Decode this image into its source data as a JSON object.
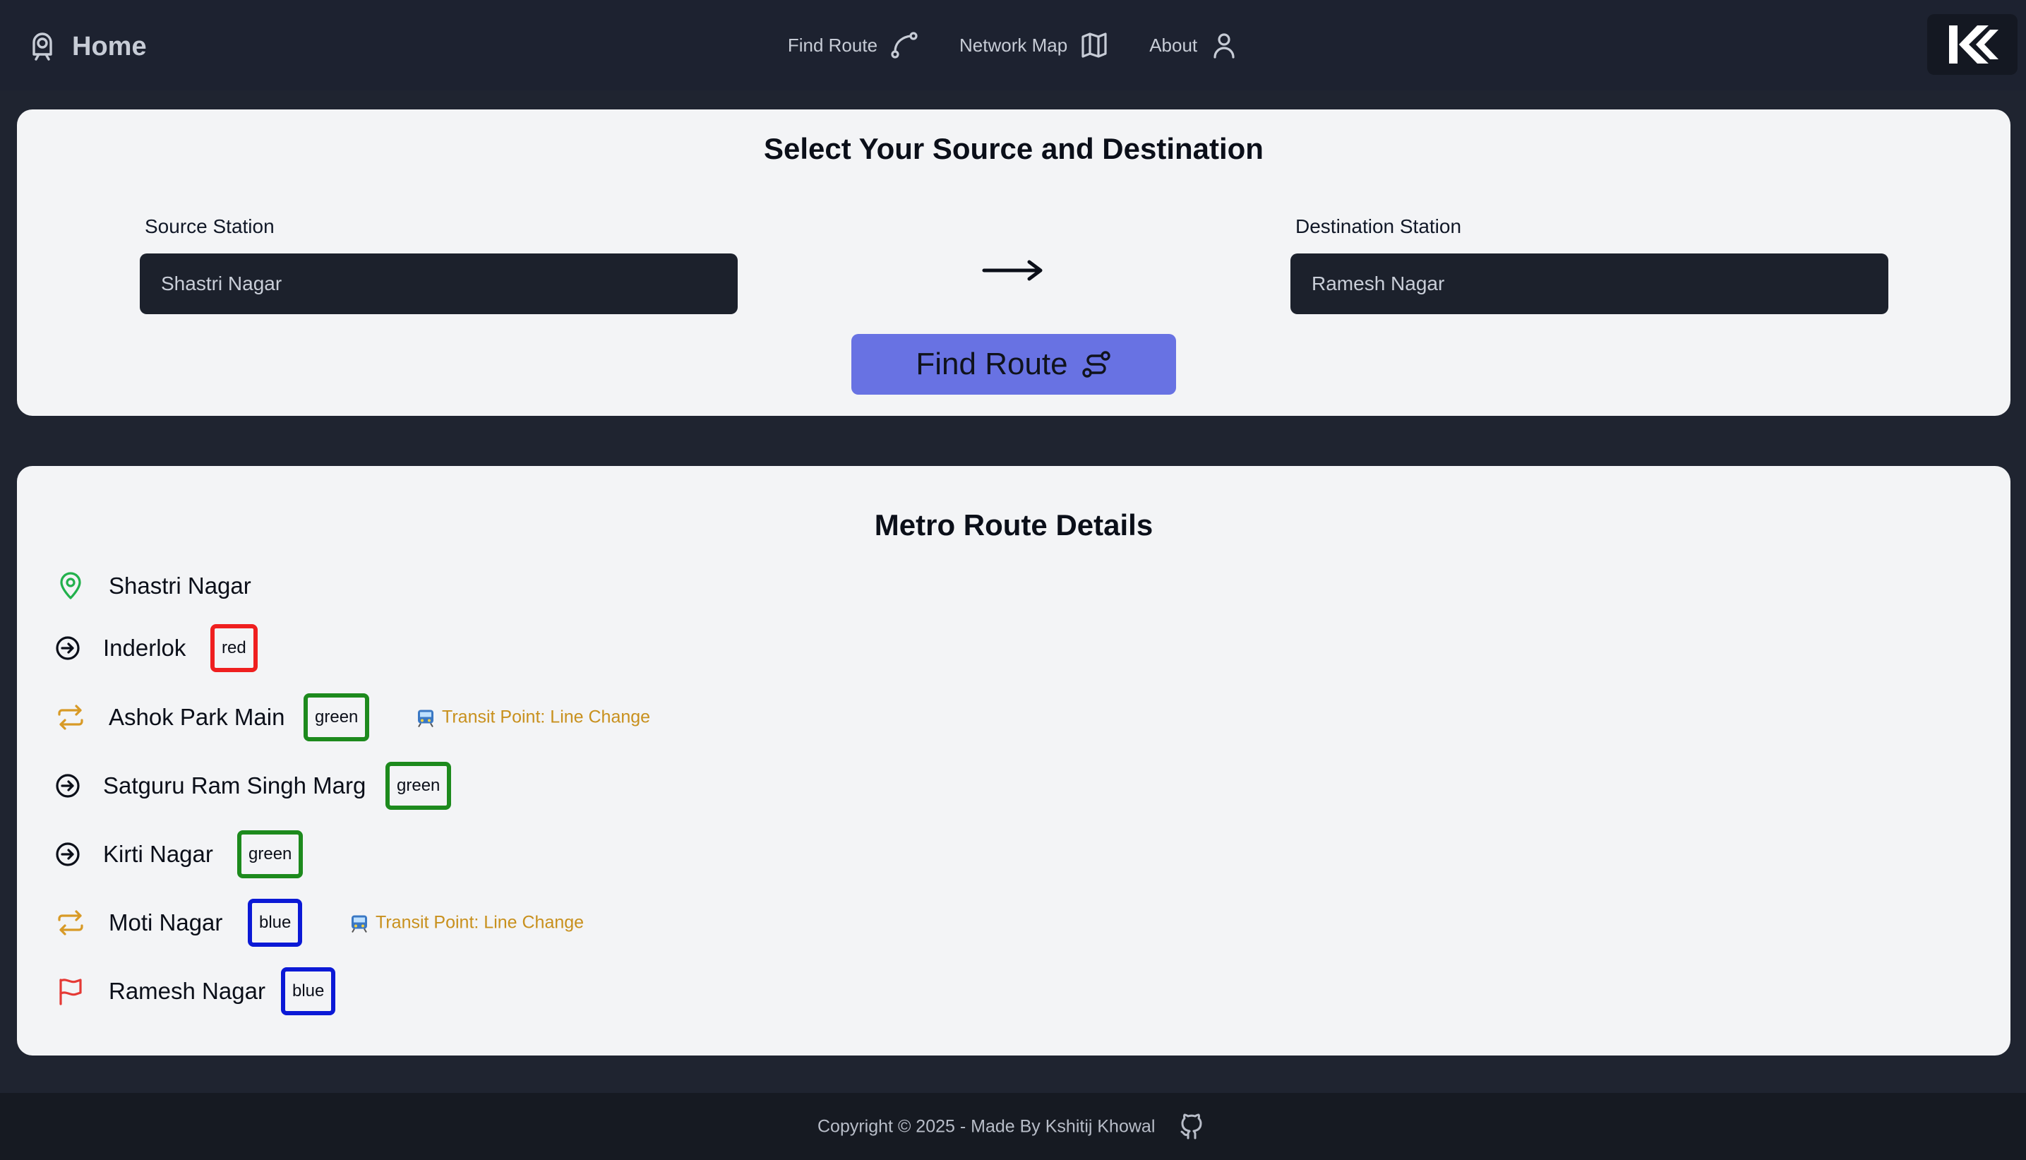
{
  "navbar": {
    "home_label": "Home",
    "links": [
      {
        "label": "Find Route",
        "icon": "route-icon"
      },
      {
        "label": "Network Map",
        "icon": "map-icon"
      },
      {
        "label": "About",
        "icon": "user-icon"
      }
    ],
    "logo_text": "K"
  },
  "selector": {
    "title": "Select Your Source and Destination",
    "source_label": "Source Station",
    "source_value": "Shastri Nagar",
    "destination_label": "Destination Station",
    "destination_value": "Ramesh Nagar",
    "find_button": "Find Route"
  },
  "route": {
    "title": "Metro Route Details",
    "transit_text": "Transit Point: Line Change",
    "stops": [
      {
        "name": "Shastri Nagar",
        "icon": "map-pin-icon",
        "line": ""
      },
      {
        "name": "Inderlok",
        "icon": "arrow-circle-icon",
        "line": "red"
      },
      {
        "name": "Ashok Park Main",
        "icon": "transfer-icon",
        "line": "green",
        "transit": true
      },
      {
        "name": "Satguru Ram Singh Marg",
        "icon": "arrow-circle-icon",
        "line": "green"
      },
      {
        "name": "Kirti Nagar",
        "icon": "arrow-circle-icon",
        "line": "green"
      },
      {
        "name": "Moti Nagar",
        "icon": "transfer-icon",
        "line": "blue",
        "transit": true
      },
      {
        "name": "Ramesh Nagar",
        "icon": "flag-icon",
        "line": "blue"
      }
    ]
  },
  "colors": {
    "red_line": "#ef1f1f",
    "green_line": "#1d8a1d",
    "blue_line": "#0b19d6",
    "transit": "#c8901d",
    "pin": "#22b14c",
    "flag": "#e53935",
    "accent_button": "#6872e3"
  },
  "footer": {
    "copyright": "Copyright © 2025 - Made By Kshitij Khowal"
  }
}
